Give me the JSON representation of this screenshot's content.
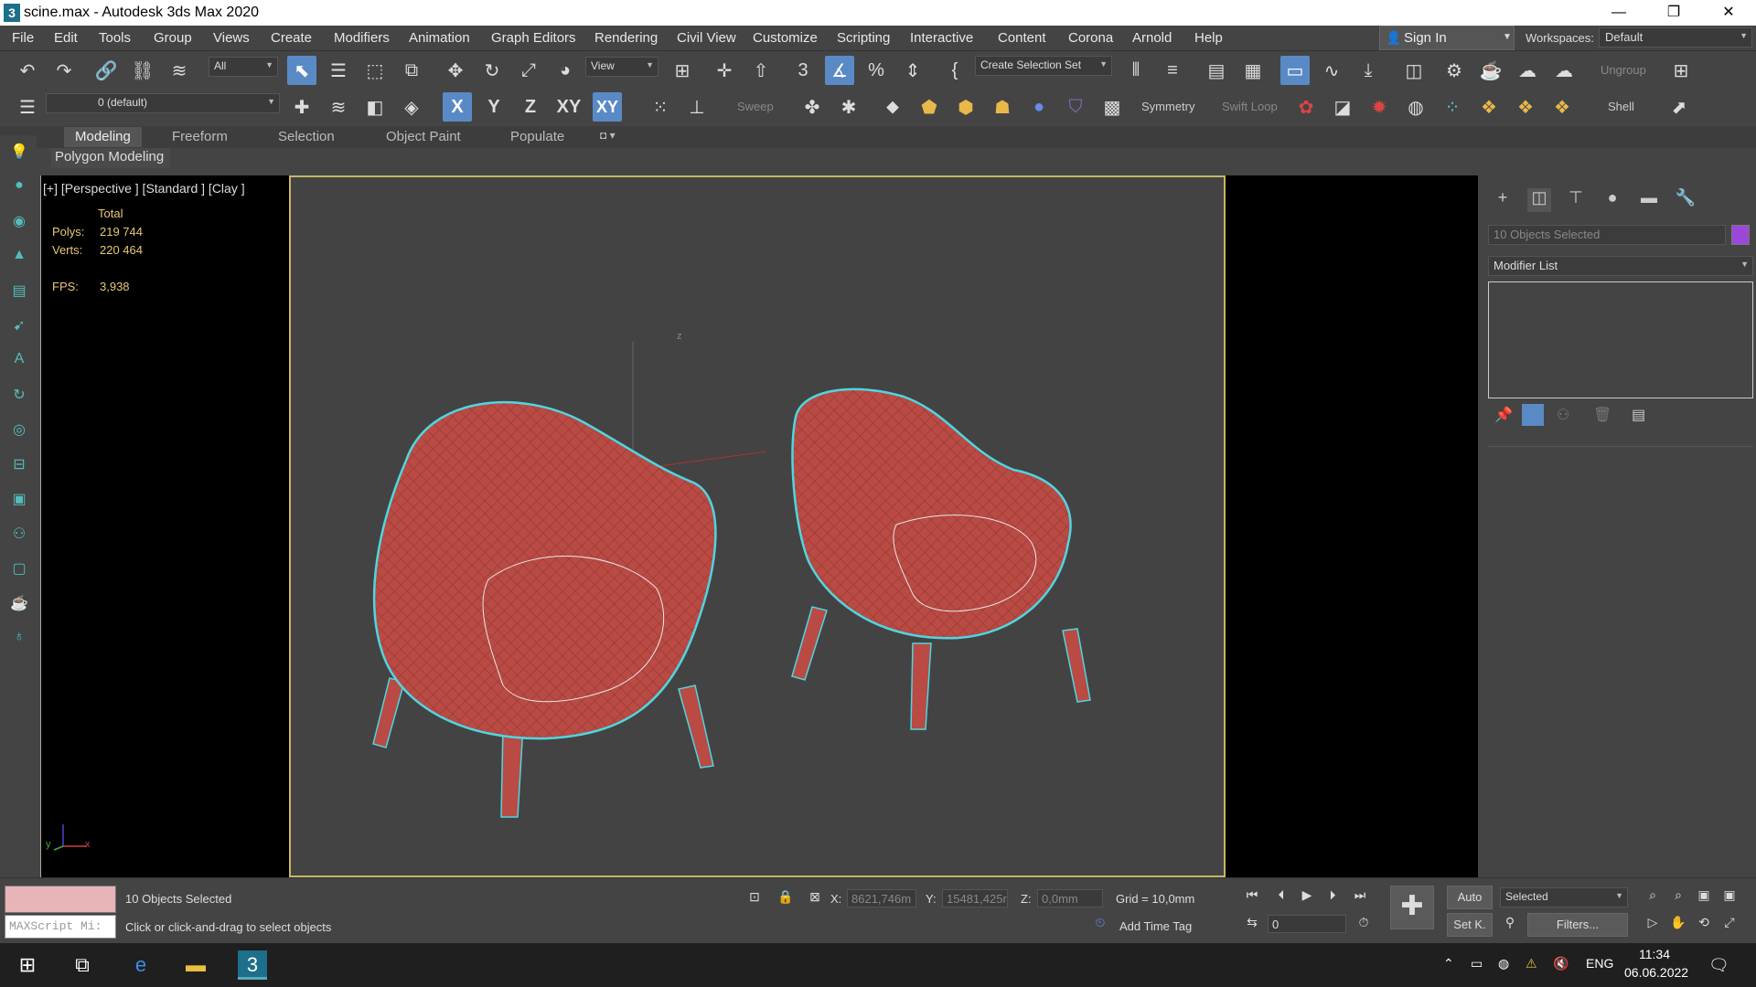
{
  "window": {
    "title": "scine.max - Autodesk 3ds Max 2020",
    "app_icon": "3",
    "minimize": "—",
    "maximize": "❐",
    "close": "✕"
  },
  "menu": [
    "File",
    "Edit",
    "Tools",
    "Group",
    "Views",
    "Create",
    "Modifiers",
    "Animation",
    "Graph Editors",
    "Rendering",
    "Civil View",
    "Customize",
    "Scripting",
    "Interactive",
    "Content",
    "Corona",
    "Arnold",
    "Help"
  ],
  "account": {
    "signin": "Sign In",
    "workspaces_label": "Workspaces:",
    "workspace": "Default"
  },
  "toolbar1": {
    "filter": "All",
    "refcoord": "View",
    "selection_set": "Create Selection Set",
    "ungroup": "Ungroup"
  },
  "toolbar2": {
    "layer": "0 (default)",
    "x": "X",
    "y": "Y",
    "z": "Z",
    "xy": "XY",
    "xyz": "XY",
    "sweep": "Sweep",
    "symmetry": "Symmetry",
    "swift_loop": "Swift Loop",
    "shell": "Shell"
  },
  "ribbon": {
    "tabs": [
      "Modeling",
      "Freeform",
      "Selection",
      "Object Paint",
      "Populate"
    ],
    "active_tab": "Modeling",
    "sub": "Polygon Modeling"
  },
  "viewport": {
    "label": "[+] [Perspective ] [Standard ] [Clay ]",
    "stats": {
      "total_label": "Total",
      "polys_label": "Polys:",
      "polys": "219 744",
      "verts_label": "Verts:",
      "verts": "220 464",
      "fps_label": "FPS:",
      "fps": "3,938"
    },
    "axis_z": "z",
    "axis_x": "x",
    "axis_y": "y",
    "object_color": "#b94a44",
    "selection_color": "#4fd6e0"
  },
  "command_panel": {
    "objects_selected": "10 Objects Selected",
    "modifier_list": "Modifier List",
    "object_color": "#9b48d8"
  },
  "status": {
    "selected": "10 Objects Selected",
    "prompt": "Click or click-and-drag to select objects",
    "maxscript": "MAXScript Mi:",
    "x_label": "X:",
    "x": "8621,746m",
    "y_label": "Y:",
    "y": "15481,425r",
    "z_label": "Z:",
    "z": "0,0mm",
    "grid": "Grid = 10,0mm",
    "add_time_tag": "Add Time Tag",
    "frame": "0",
    "auto": "Auto",
    "set_key": "Set K.",
    "selected_dd": "Selected",
    "filters": "Filters..."
  },
  "taskbar": {
    "lang": "ENG",
    "time": "11:34",
    "date": "06.06.2022"
  }
}
